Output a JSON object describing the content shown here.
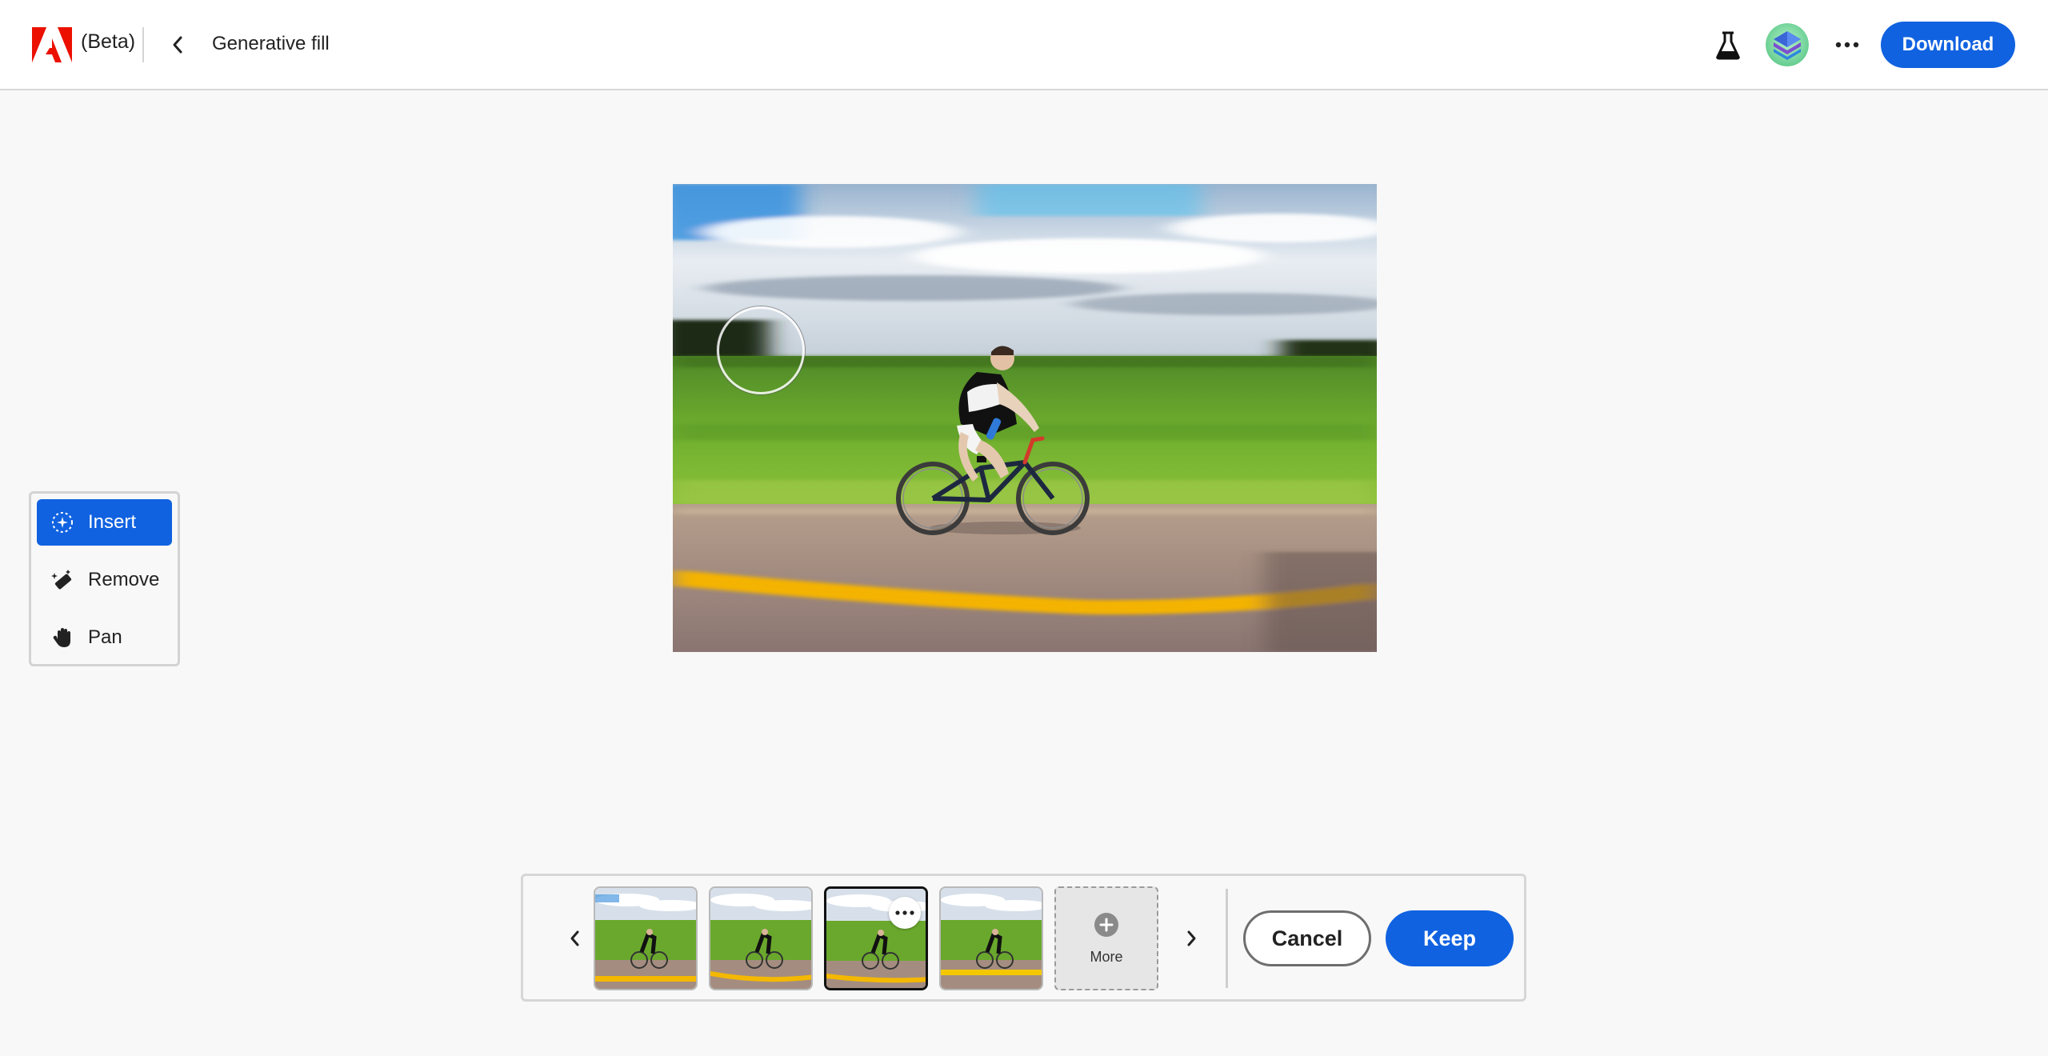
{
  "header": {
    "app_badge": "(Beta)",
    "title": "Generative fill",
    "download_label": "Download",
    "icons": {
      "logo": "adobe-logo",
      "back": "chevron-left-icon",
      "labs": "beaker-icon",
      "more": "ellipsis-icon"
    }
  },
  "tools": {
    "items": [
      {
        "label": "Insert",
        "icon": "sparkle-brush-icon",
        "active": true
      },
      {
        "label": "Remove",
        "icon": "eraser-sparkle-icon",
        "active": false
      },
      {
        "label": "Pan",
        "icon": "hand-icon",
        "active": false
      }
    ]
  },
  "variations": {
    "count": 4,
    "selected_index": 3,
    "more_label": "More",
    "cancel_label": "Cancel",
    "keep_label": "Keep"
  },
  "colors": {
    "accent": "#1062e0",
    "background": "#f8f8f8",
    "adobe_red": "#eb1000"
  }
}
